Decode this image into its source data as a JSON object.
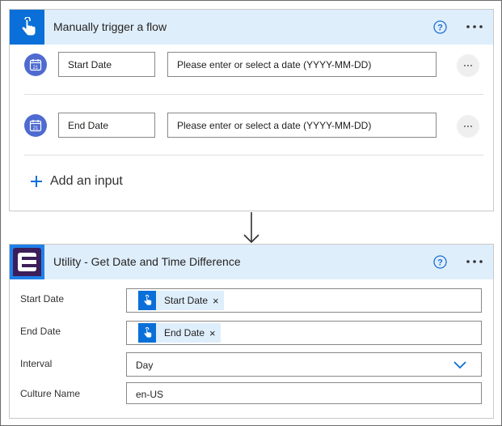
{
  "trigger": {
    "title": "Manually trigger a flow",
    "inputs": [
      {
        "name": "Start Date",
        "placeholder": "Please enter or select a date (YYYY-MM-DD)"
      },
      {
        "name": "End Date",
        "placeholder": "Please enter or select a date (YYYY-MM-DD)"
      }
    ],
    "add_input_label": "Add an input"
  },
  "action": {
    "title": "Utility - Get Date and Time Difference",
    "params": [
      {
        "label": "Start Date",
        "token": "Start Date"
      },
      {
        "label": "End Date",
        "token": "End Date"
      },
      {
        "label": "Interval",
        "value": "Day"
      },
      {
        "label": "Culture Name",
        "value": "en-US"
      }
    ]
  },
  "icons": {
    "trigger": "touch-hand-icon",
    "action": "utility-connector-icon",
    "calendar": "calendar-icon",
    "help": "help-icon",
    "more": "more-options-icon",
    "add": "plus-icon",
    "arrow": "down-arrow-icon",
    "dropdown": "chevron-down-icon",
    "remove": "remove-token-icon"
  },
  "colors": {
    "header_bg": "#dfeefb",
    "trigger_icon_bg": "#0a6fd8",
    "calendar_bg": "#4f6bd0",
    "accent": "#0a6fd8"
  }
}
